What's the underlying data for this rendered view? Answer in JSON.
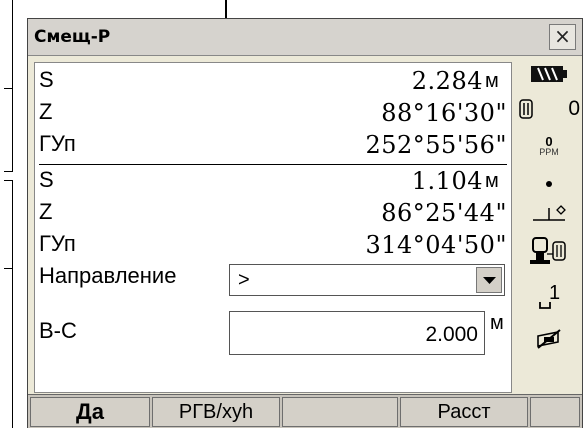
{
  "window": {
    "title": "Смещ-Р",
    "close_glyph": "×"
  },
  "block1": {
    "rows": [
      {
        "label": "S",
        "value": "2.284",
        "unit": "м"
      },
      {
        "label": "Z",
        "value": "88°16'30\""
      },
      {
        "label": "ГУп",
        "value": "252°55'56\""
      }
    ]
  },
  "block2": {
    "rows": [
      {
        "label": "S",
        "value": "1.104",
        "unit": "м"
      },
      {
        "label": "Z",
        "value": "86°25'44\""
      },
      {
        "label": "ГУп",
        "value": "314°04'50\""
      }
    ]
  },
  "direction": {
    "label": "Направление",
    "value": ">"
  },
  "bc": {
    "label": "В-С",
    "value": "2.000",
    "unit": "м"
  },
  "status": {
    "battery_icon": "battery-icon",
    "prism_icon": "prism-icon",
    "prism_constant": "0",
    "ppm_label": "PPM",
    "ppm_value": "0",
    "ppm_icon": "ppm-icon",
    "point_icon": "dot-icon",
    "tilt_icon": "tilt-icon",
    "mode_icon": "instrument-icon",
    "face": "1",
    "face_icon": "face-icon",
    "signal_icon": "signal-icon"
  },
  "softkeys": [
    {
      "label": "Да"
    },
    {
      "label": "РГВ/xyh"
    },
    {
      "label": ""
    },
    {
      "label": "Расст"
    },
    {
      "label": ""
    }
  ],
  "colors": {
    "window_bg": "#ece9d8",
    "panel_bg": "#ffffff",
    "softkey_bg": "#d4d0c8"
  }
}
